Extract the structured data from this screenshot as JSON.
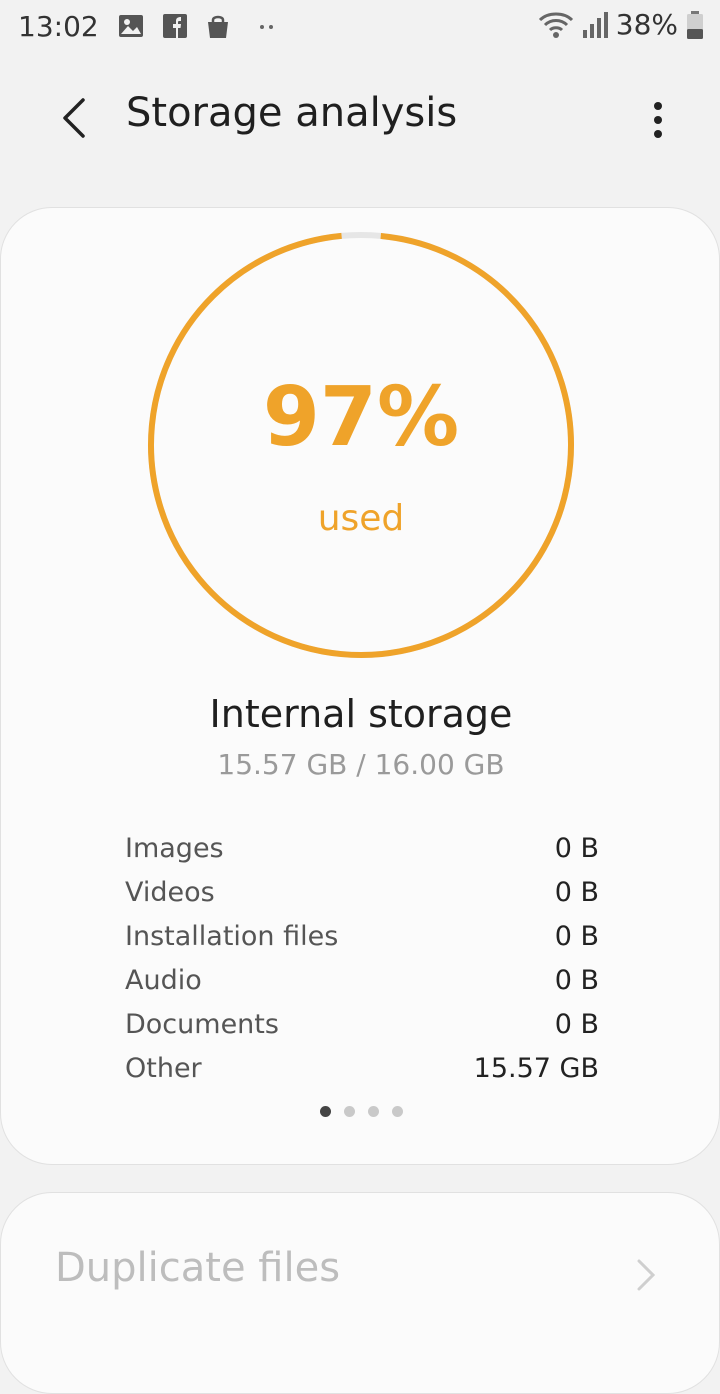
{
  "status_bar": {
    "time": "13:02",
    "notification_icons": [
      "image-icon",
      "facebook-icon",
      "shopping-bag-icon",
      "more-dots-icon"
    ],
    "battery_text": "38%",
    "right_icons": [
      "wifi-icon",
      "signal-icon",
      "battery-icon"
    ]
  },
  "app_bar": {
    "title": "Storage analysis",
    "back_icon": "chevron-left-icon",
    "menu_icon": "more-vert-icon"
  },
  "storage_card": {
    "percent_label": "97%",
    "used_label": "used",
    "used_fraction": 0.97,
    "accent_color": "#efa32a",
    "track_color": "#e6e6e6",
    "storage_name": "Internal storage",
    "storage_size": "15.57 GB / 16.00 GB",
    "categories": [
      {
        "label": "Images",
        "value": "0 B"
      },
      {
        "label": "Videos",
        "value": "0 B"
      },
      {
        "label": "Installation files",
        "value": "0 B"
      },
      {
        "label": "Audio",
        "value": "0 B"
      },
      {
        "label": "Documents",
        "value": "0 B"
      },
      {
        "label": "Other",
        "value": "15.57 GB"
      }
    ],
    "page_indicator": {
      "count": 4,
      "active": 0
    }
  },
  "next_card": {
    "title": "Duplicate files"
  }
}
